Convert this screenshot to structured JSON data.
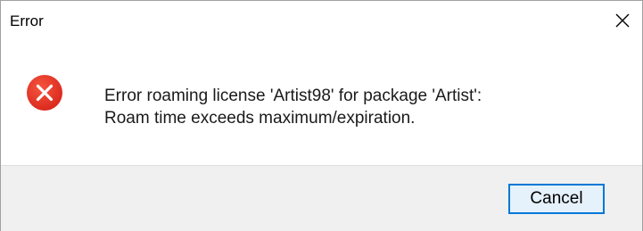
{
  "window": {
    "title": "Error",
    "close_icon": "close-icon"
  },
  "message": {
    "line1": "Error roaming license 'Artist98' for package 'Artist':",
    "line2": "Roam time exceeds maximum/expiration.",
    "icon": "error-icon"
  },
  "buttons": {
    "cancel_label": "Cancel"
  },
  "colors": {
    "error_red": "#e81123",
    "button_border": "#0078d7",
    "button_fill": "#e5f1fb",
    "footer_bg": "#f0f0f0"
  }
}
